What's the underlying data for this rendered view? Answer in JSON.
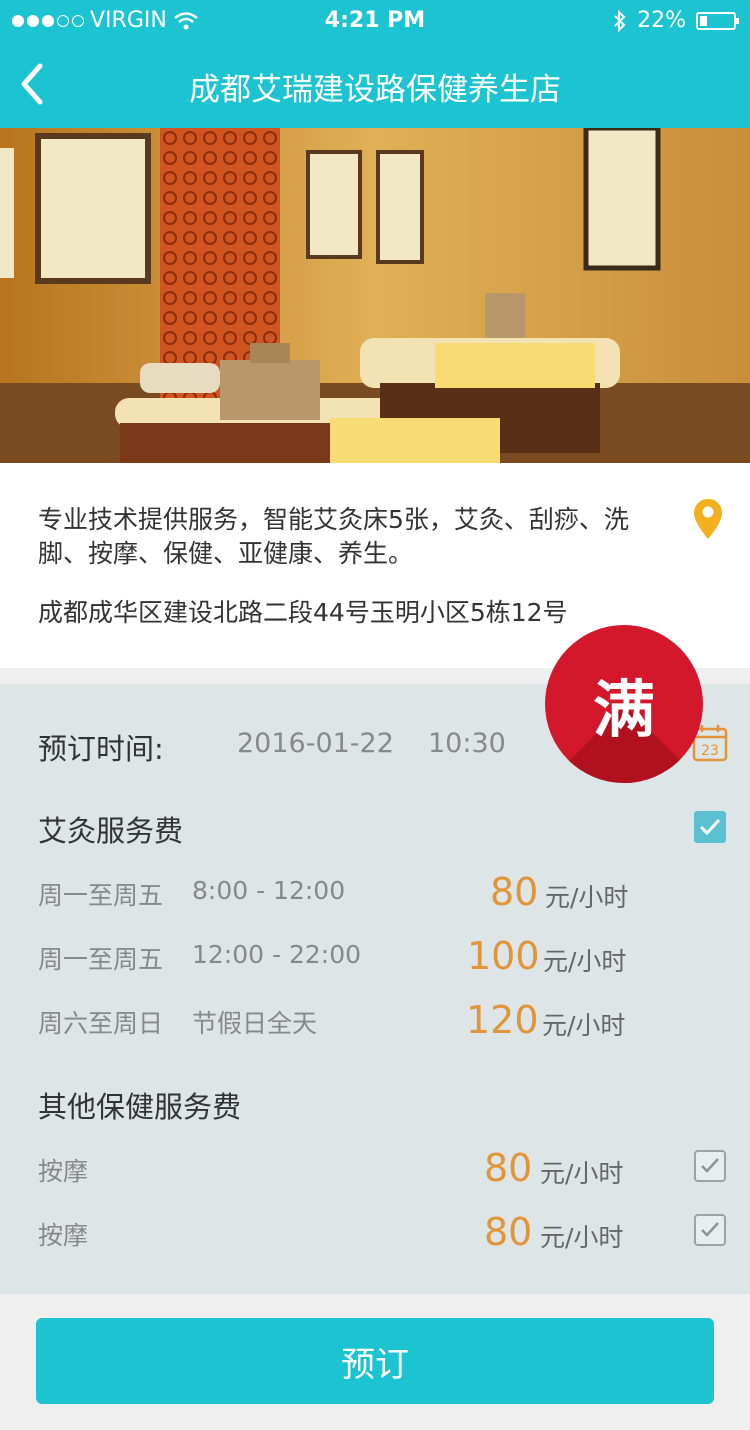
{
  "status_bar": {
    "carrier": "VIRGIN",
    "time": "4:21 PM",
    "battery": "22%",
    "battery_level": 0.22
  },
  "nav": {
    "title": "成都艾瑞建设路保健养生店"
  },
  "store": {
    "description": "专业技术提供服务，智能艾灸床5张，艾灸、刮痧、洗脚、按摩、保健、亚健康、养生。",
    "address": "成都成华区建设北路二段44号玉明小区5栋12号"
  },
  "full_badge": "满",
  "booking": {
    "label": "预订时间:",
    "date": "2016-01-22",
    "time": "10:30",
    "calendar_day": "23"
  },
  "moxa": {
    "title": "艾灸服务费",
    "checked": true,
    "rows": [
      {
        "days": "周一至周五",
        "hours": "8:00 - 12:00",
        "price": "80",
        "unit": "元/小时"
      },
      {
        "days": "周一至周五",
        "hours": "12:00 - 22:00",
        "price": "100",
        "unit": "元/小时"
      },
      {
        "days": "周六至周日",
        "hours": "节假日全天",
        "price": "120",
        "unit": "元/小时"
      }
    ]
  },
  "other": {
    "title": "其他保健服务费",
    "rows": [
      {
        "name": "按摩",
        "price": "80",
        "unit": "元/小时",
        "checked": true
      },
      {
        "name": "按摩",
        "price": "80",
        "unit": "元/小时",
        "checked": true
      }
    ]
  },
  "book_button": "预订",
  "colors": {
    "accent": "#1cc4d2",
    "price": "#e0953a",
    "badge": "#d3182b",
    "pin": "#f2b01e"
  }
}
